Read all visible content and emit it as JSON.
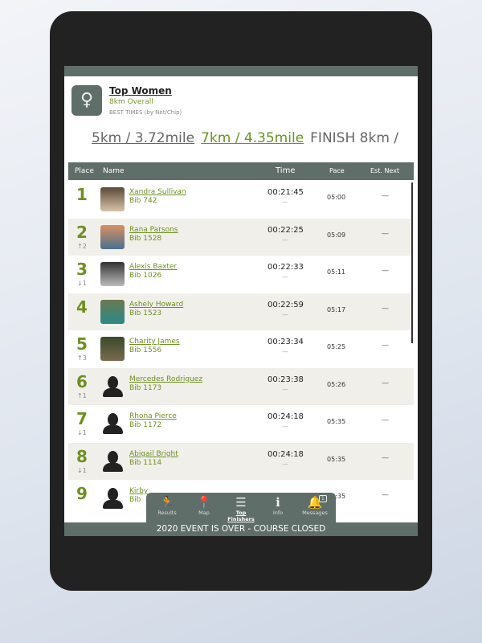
{
  "header": {
    "title": "Top Women",
    "subtitle": "8km Overall",
    "note": "BEST TIMES (by Net/Chip)"
  },
  "splits": [
    "5km / 3.72mile",
    "7km / 4.35mile",
    "FINISH 8km /"
  ],
  "columns": {
    "place": "Place",
    "name": "Name",
    "time": "Time",
    "pace": "Pace",
    "next": "Est. Next"
  },
  "rows": [
    {
      "place": "1",
      "change": "",
      "name": "Xandra Sullivan",
      "bib": "Bib 742",
      "time": "00:21:45",
      "tsub": "—",
      "pace": "05:00",
      "next": "—",
      "avatar": "ph1"
    },
    {
      "place": "2",
      "change": "↑2",
      "name": "Rana Parsons",
      "bib": "Bib 1528",
      "time": "00:22:25",
      "tsub": "—",
      "pace": "05:09",
      "next": "—",
      "avatar": "ph2"
    },
    {
      "place": "3",
      "change": "↓1",
      "name": "Alexis Baxter",
      "bib": "Bib 1026",
      "time": "00:22:33",
      "tsub": "—",
      "pace": "05:11",
      "next": "—",
      "avatar": "ph3"
    },
    {
      "place": "4",
      "change": "",
      "name": "Ashely Howard",
      "bib": "Bib 1523",
      "time": "00:22:59",
      "tsub": "—",
      "pace": "05:17",
      "next": "—",
      "avatar": "ph4"
    },
    {
      "place": "5",
      "change": "↑3",
      "name": "Charity James",
      "bib": "Bib 1556",
      "time": "00:23:34",
      "tsub": "—",
      "pace": "05:25",
      "next": "—",
      "avatar": "ph5"
    },
    {
      "place": "6",
      "change": "↑1",
      "name": "Mercedes Rodriguez",
      "bib": "Bib 1173",
      "time": "00:23:38",
      "tsub": "—",
      "pace": "05:26",
      "next": "—",
      "avatar": "sil"
    },
    {
      "place": "7",
      "change": "↓1",
      "name": "Rhona Pierce",
      "bib": "Bib 1172",
      "time": "00:24:18",
      "tsub": "—",
      "pace": "05:35",
      "next": "—",
      "avatar": "sil"
    },
    {
      "place": "8",
      "change": "↓1",
      "name": "Abigail Bright",
      "bib": "Bib 1114",
      "time": "00:24:18",
      "tsub": "—",
      "pace": "05:35",
      "next": "—",
      "avatar": "sil"
    },
    {
      "place": "9",
      "change": "",
      "name": "Kirby",
      "bib": "Bib",
      "time": "",
      "tsub": "",
      "pace": "05:35",
      "next": "—",
      "avatar": "sil"
    }
  ],
  "nav": [
    {
      "label": "Results",
      "icon": "runner-icon",
      "glyph": "🏃"
    },
    {
      "label": "Map",
      "icon": "map-pin-icon",
      "glyph": "📍"
    },
    {
      "label": "Top Finishers",
      "icon": "list-icon",
      "glyph": "☰",
      "active": true
    },
    {
      "label": "Info",
      "icon": "info-icon",
      "glyph": "ℹ"
    },
    {
      "label": "Messages",
      "icon": "bell-icon",
      "glyph": "🔔",
      "badge": "1"
    }
  ],
  "status": "2020 EVENT IS OVER - COURSE CLOSED",
  "colors": {
    "accent": "#6e9022",
    "bar": "#5f6e69"
  }
}
